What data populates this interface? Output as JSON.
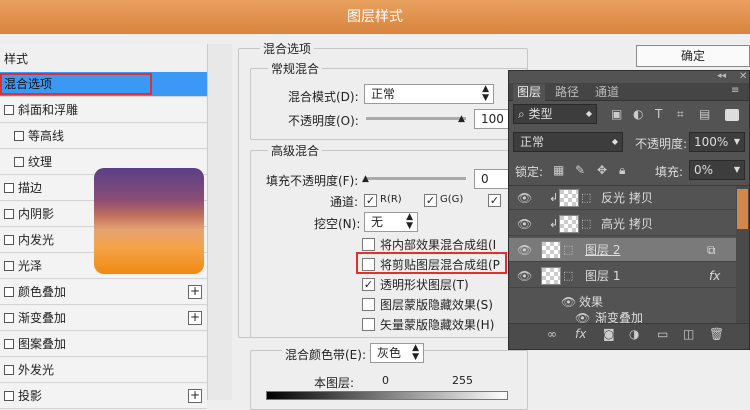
{
  "title": "图层样式",
  "ok": "确定",
  "left": {
    "header": "样式",
    "items": [
      {
        "label": "混合选项",
        "checkbox": false,
        "selected": true,
        "plus": false,
        "indent": 0
      },
      {
        "label": "斜面和浮雕",
        "checkbox": true,
        "plus": false,
        "indent": 0
      },
      {
        "label": "等高线",
        "checkbox": true,
        "plus": false,
        "indent": 1
      },
      {
        "label": "纹理",
        "checkbox": true,
        "plus": false,
        "indent": 1
      },
      {
        "label": "描边",
        "checkbox": true,
        "plus": false,
        "indent": 0
      },
      {
        "label": "内阴影",
        "checkbox": true,
        "plus": false,
        "indent": 0
      },
      {
        "label": "内发光",
        "checkbox": true,
        "plus": false,
        "indent": 0
      },
      {
        "label": "光泽",
        "checkbox": true,
        "plus": false,
        "indent": 0
      },
      {
        "label": "颜色叠加",
        "checkbox": true,
        "plus": true,
        "indent": 0
      },
      {
        "label": "渐变叠加",
        "checkbox": true,
        "plus": true,
        "indent": 0
      },
      {
        "label": "图案叠加",
        "checkbox": true,
        "plus": false,
        "indent": 0
      },
      {
        "label": "外发光",
        "checkbox": true,
        "plus": false,
        "indent": 0
      },
      {
        "label": "投影",
        "checkbox": true,
        "plus": true,
        "indent": 0
      }
    ]
  },
  "blend": {
    "section": "混合选项",
    "general": "常规混合",
    "mode_label": "混合模式(D):",
    "mode_value": "正常",
    "opacity_label": "不透明度(O):",
    "opacity_value": "100",
    "advanced": "高级混合",
    "fill_label": "填充不透明度(F):",
    "fill_value": "0",
    "channels_label": "通道:",
    "ch_r": "R(R)",
    "ch_g": "G(G)",
    "ch_b": "B",
    "knockout_label": "挖空(N):",
    "knockout_value": "无",
    "opts": [
      "将内部效果混合成组(I",
      "将剪贴图层混合成组(P",
      "透明形状图层(T)",
      "图层蒙版隐藏效果(S)",
      "矢量蒙版隐藏效果(H)"
    ],
    "opts_checked": [
      false,
      false,
      true,
      false,
      false
    ],
    "blendif_label": "混合颜色带(E):",
    "blendif_value": "灰色",
    "this_layer": "本图层:",
    "min": "0",
    "max": "255"
  },
  "layers": {
    "tabs": [
      "图层",
      "路径",
      "通道"
    ],
    "kind": "类型",
    "mode": "正常",
    "opacity_label": "不透明度:",
    "opacity": "100%",
    "lock_label": "锁定:",
    "fill_label": "填充:",
    "fill": "0%",
    "rows": [
      {
        "name": "反光 拷贝"
      },
      {
        "name": "高光 拷贝"
      },
      {
        "name": "图层 2"
      },
      {
        "name": "图层 1"
      }
    ],
    "effects": "效果",
    "effect_item": "渐变叠加"
  }
}
